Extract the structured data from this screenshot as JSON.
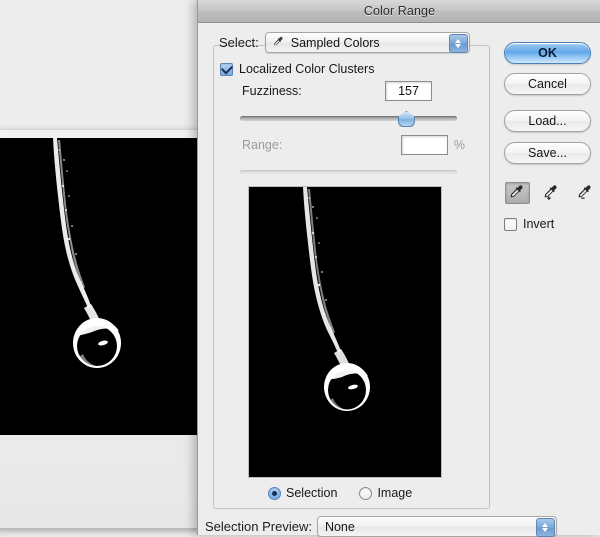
{
  "window": {
    "title": "Color Range"
  },
  "select": {
    "label": "Select:",
    "value": "Sampled Colors",
    "icon": "eyedropper-icon"
  },
  "localized_clusters": {
    "label": "Localized Color Clusters",
    "checked": true
  },
  "fuzziness": {
    "label": "Fuzziness:",
    "value": "157",
    "slider_percent": 76
  },
  "range": {
    "label": "Range:",
    "value": "",
    "unit": "%",
    "enabled": false,
    "slider_percent": 0
  },
  "preview_mode": {
    "selection": {
      "label": "Selection",
      "checked": true
    },
    "image": {
      "label": "Image",
      "checked": false
    }
  },
  "buttons": {
    "ok": "OK",
    "cancel": "Cancel",
    "load": "Load...",
    "save": "Save..."
  },
  "eyedroppers": [
    {
      "name": "eyedropper-icon",
      "selected": true
    },
    {
      "name": "eyedropper-add-icon",
      "selected": false
    },
    {
      "name": "eyedropper-subtract-icon",
      "selected": false
    }
  ],
  "invert": {
    "label": "Invert",
    "checked": false
  },
  "selection_preview": {
    "label": "Selection Preview:",
    "value": "None"
  },
  "colors": {
    "accent_blue": "#5ea5e8",
    "dialog_bg": "#ededed",
    "canvas_black": "#000000",
    "title_bar": "#c6c6c6"
  },
  "document": {
    "subject": "water-droplet-photo"
  }
}
